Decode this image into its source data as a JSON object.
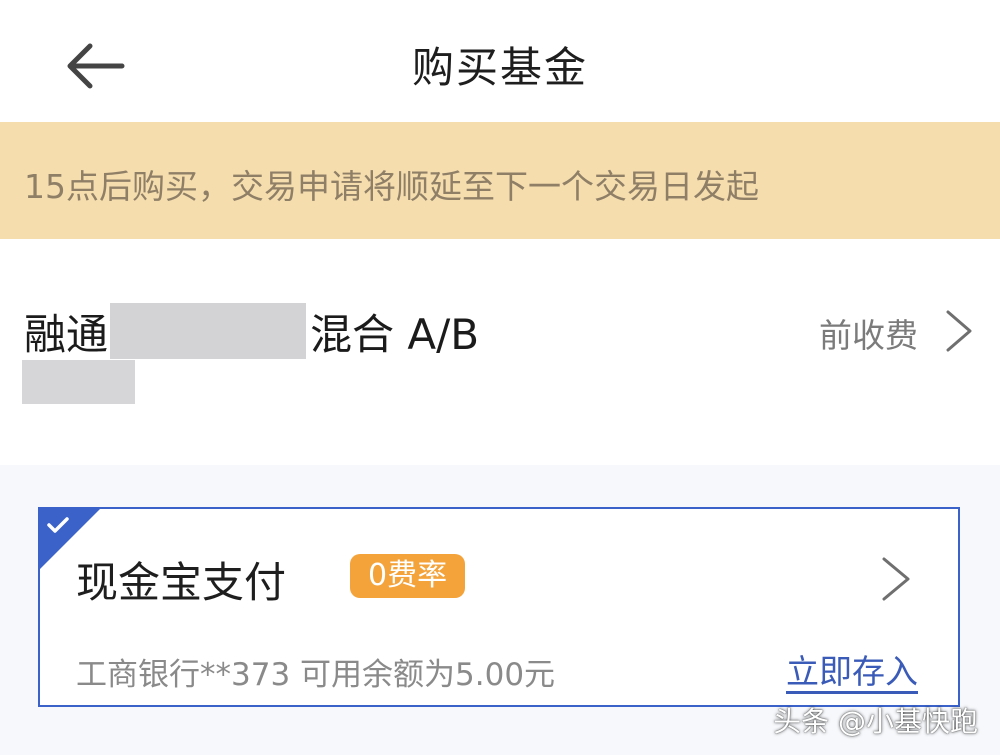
{
  "header": {
    "title": "购买基金",
    "back_icon": "arrow-left-icon"
  },
  "notice": {
    "text": "15点后购买，交易申请将顺延至下一个交易日发起",
    "background": "#f5ddae"
  },
  "fund": {
    "name_prefix": "融通",
    "name_suffix": "混合 A/B",
    "fee_type": "前收费",
    "chevron_icon": "chevron-right-icon"
  },
  "payment": {
    "method": "现金宝支付",
    "selected": true,
    "rate_badge": "0费率",
    "bank_info": "工商银行**373 可用余额为5.00元",
    "deposit_link": "立即存入",
    "check_icon": "checkmark-icon",
    "accent_color": "#3a62c9",
    "badge_color": "#f4a33a"
  },
  "watermark": {
    "text": "头条 @小基快跑"
  }
}
